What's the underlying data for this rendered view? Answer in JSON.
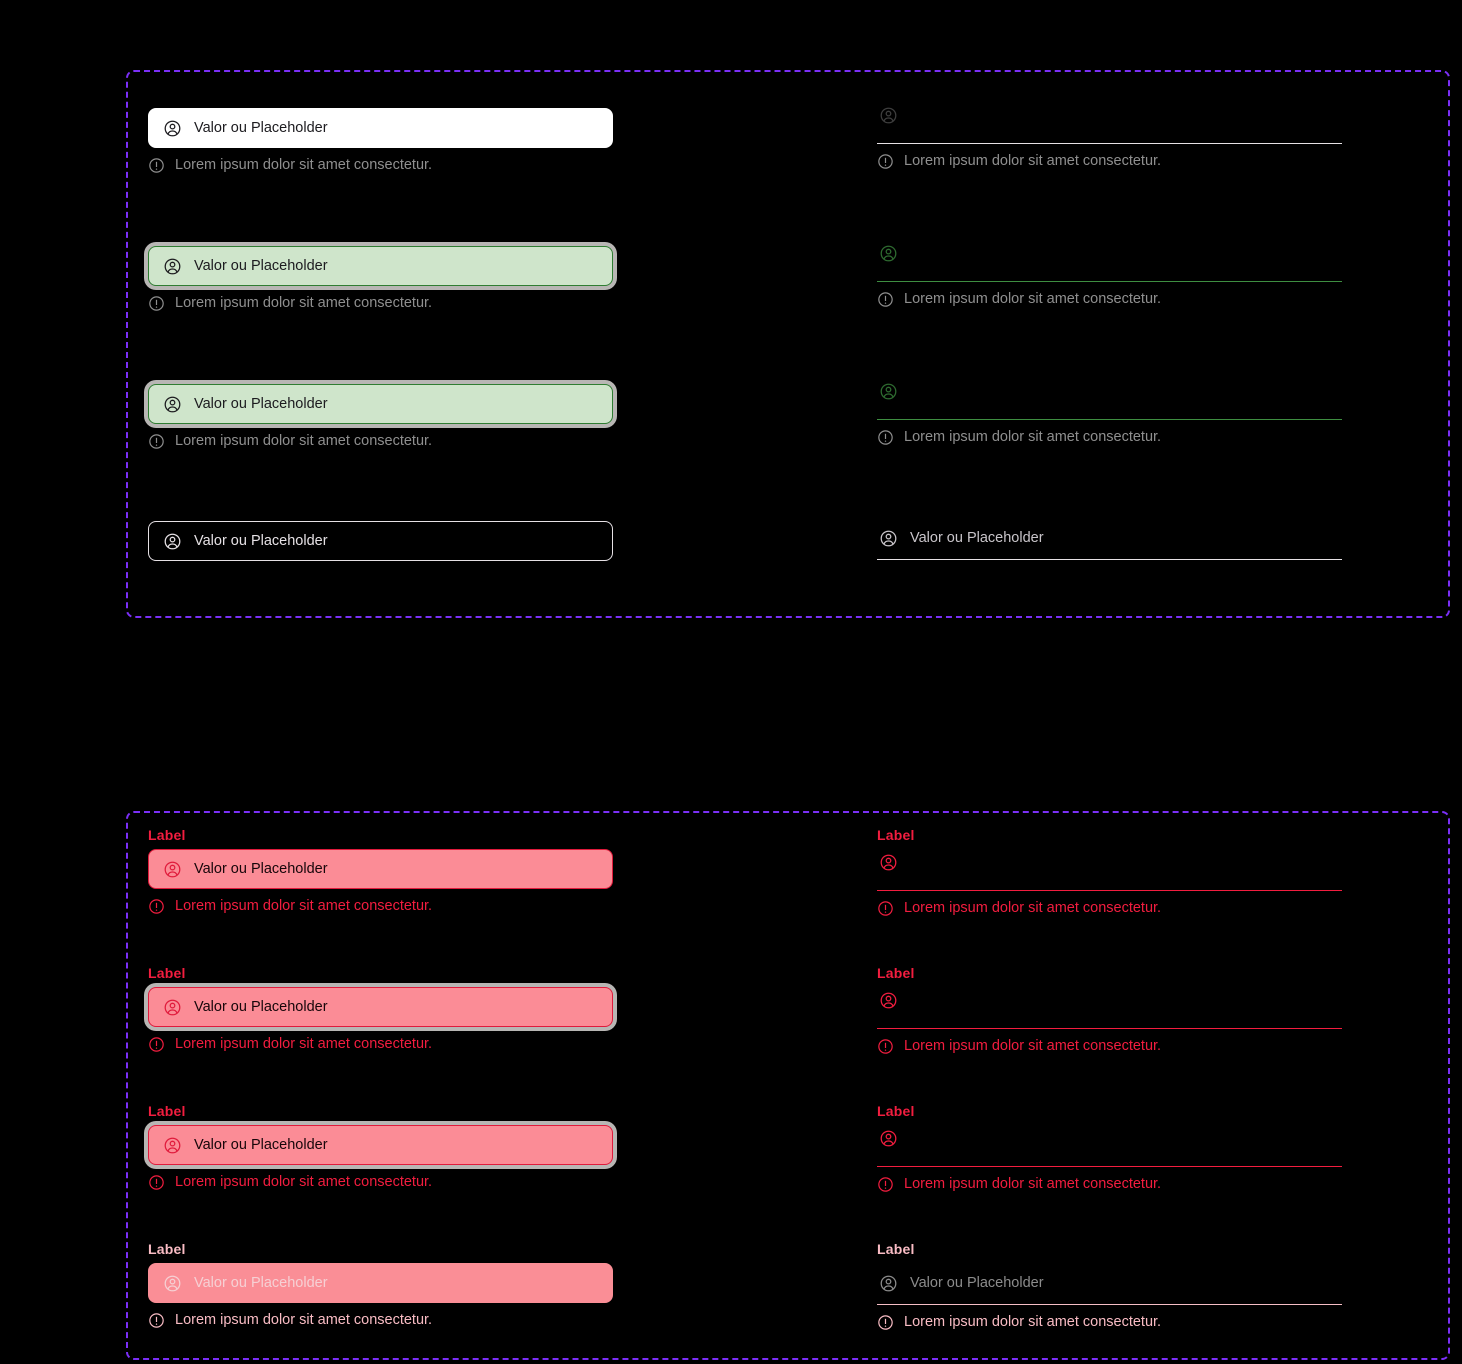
{
  "page": {
    "background": "#000000",
    "frame_border_color": "#7B2FF7"
  },
  "colors": {
    "white": "#FFFFFF",
    "success_border": "#2F7D32",
    "success_fill": "#CFE5CB",
    "success_underline": "#3E8E41",
    "error": "#F21D3F",
    "error_fill": "#FB8C96",
    "error_border": "#E01B3C",
    "disabled_label": "#F9BCC4",
    "helper_muted": "#8F8F8F",
    "outline": "#E6E1E5"
  },
  "strings": {
    "placeholder": "Valor ou Placeholder",
    "helper": "Lorem ipsum dolor sit amet consectetur.",
    "label": "Label",
    "person_icon": "account-circle-icon",
    "info_icon": "info-circle-icon"
  },
  "sections": [
    {
      "name": "default-states",
      "left": [
        {
          "id": "outlined-default",
          "variant": "boxed",
          "style": "box-default",
          "ring": false,
          "value": "Valor ou Placeholder",
          "helper": "Lorem ipsum dolor sit amet consectetur.",
          "helper_style": "help-muted",
          "label": null
        },
        {
          "id": "outlined-success-hover",
          "variant": "boxed",
          "style": "box-success",
          "ring": true,
          "value": "Valor ou Placeholder",
          "helper": "Lorem ipsum dolor sit amet consectetur.",
          "helper_style": "help-muted",
          "label": null
        },
        {
          "id": "outlined-success-focus",
          "variant": "boxed",
          "style": "box-success",
          "ring": true,
          "value": "Valor ou Placeholder",
          "helper": "Lorem ipsum dolor sit amet consectetur.",
          "helper_style": "help-muted",
          "label": null
        },
        {
          "id": "outlined-dark",
          "variant": "boxed",
          "style": "box-dark",
          "ring": false,
          "value": "Valor ou Placeholder",
          "helper": null,
          "helper_style": null,
          "label": null
        }
      ],
      "right": [
        {
          "id": "underline-default-empty",
          "variant": "underline",
          "style": "ul-default",
          "value": "",
          "helper": "Lorem ipsum dolor sit amet consectetur.",
          "helper_style": "help-muted",
          "label": null
        },
        {
          "id": "underline-success-empty-hover",
          "variant": "underline",
          "style": "ul-success",
          "value": "",
          "helper": "Lorem ipsum dolor sit amet consectetur.",
          "helper_style": "help-muted",
          "label": null
        },
        {
          "id": "underline-success-empty-focus",
          "variant": "underline",
          "style": "ul-success",
          "value": "",
          "helper": "Lorem ipsum dolor sit amet consectetur.",
          "helper_style": "help-muted",
          "label": null
        },
        {
          "id": "underline-filled",
          "variant": "underline",
          "style": "ul-filled",
          "value": "Valor ou Placeholder",
          "helper": null,
          "helper_style": null,
          "label": null
        }
      ]
    },
    {
      "name": "error-states",
      "left": [
        {
          "id": "outlined-error",
          "variant": "boxed",
          "style": "box-error",
          "ring": false,
          "value": "Valor ou Placeholder",
          "helper": "Lorem ipsum dolor sit amet consectetur.",
          "helper_style": "help-error",
          "label": "Label",
          "label_style": "lbl-error"
        },
        {
          "id": "outlined-error-hover",
          "variant": "boxed",
          "style": "box-error",
          "ring": true,
          "value": "Valor ou Placeholder",
          "helper": "Lorem ipsum dolor sit amet consectetur.",
          "helper_style": "help-error",
          "label": "Label",
          "label_style": "lbl-error"
        },
        {
          "id": "outlined-error-focus",
          "variant": "boxed",
          "style": "box-error",
          "ring": true,
          "value": "Valor ou Placeholder",
          "helper": "Lorem ipsum dolor sit amet consectetur.",
          "helper_style": "help-error",
          "label": "Label",
          "label_style": "lbl-error"
        },
        {
          "id": "outlined-error-disabled",
          "variant": "boxed",
          "style": "box-error-disabled",
          "ring": false,
          "value": "Valor ou Placeholder",
          "helper": "Lorem ipsum dolor sit amet consectetur.",
          "helper_style": "help-disabled",
          "label": "Label",
          "label_style": "lbl-disabled"
        }
      ],
      "right": [
        {
          "id": "underline-error-empty",
          "variant": "underline",
          "style": "ul-error",
          "value": "",
          "helper": "Lorem ipsum dolor sit amet consectetur.",
          "helper_style": "help-error",
          "label": "Label",
          "label_style": "lbl-error"
        },
        {
          "id": "underline-error-empty-hover",
          "variant": "underline",
          "style": "ul-error",
          "value": "",
          "helper": "Lorem ipsum dolor sit amet consectetur.",
          "helper_style": "help-error",
          "label": "Label",
          "label_style": "lbl-error"
        },
        {
          "id": "underline-error-empty-focus",
          "variant": "underline",
          "style": "ul-error",
          "value": "",
          "helper": "Lorem ipsum dolor sit amet consectetur.",
          "helper_style": "help-error",
          "label": "Label",
          "label_style": "lbl-error"
        },
        {
          "id": "underline-error-disabled",
          "variant": "underline",
          "style": "ul-disabled",
          "value": "Valor ou Placeholder",
          "helper": "Lorem ipsum dolor sit amet consectetur.",
          "helper_style": "help-disabled",
          "label": "Label",
          "label_style": "lbl-disabled"
        }
      ]
    }
  ]
}
